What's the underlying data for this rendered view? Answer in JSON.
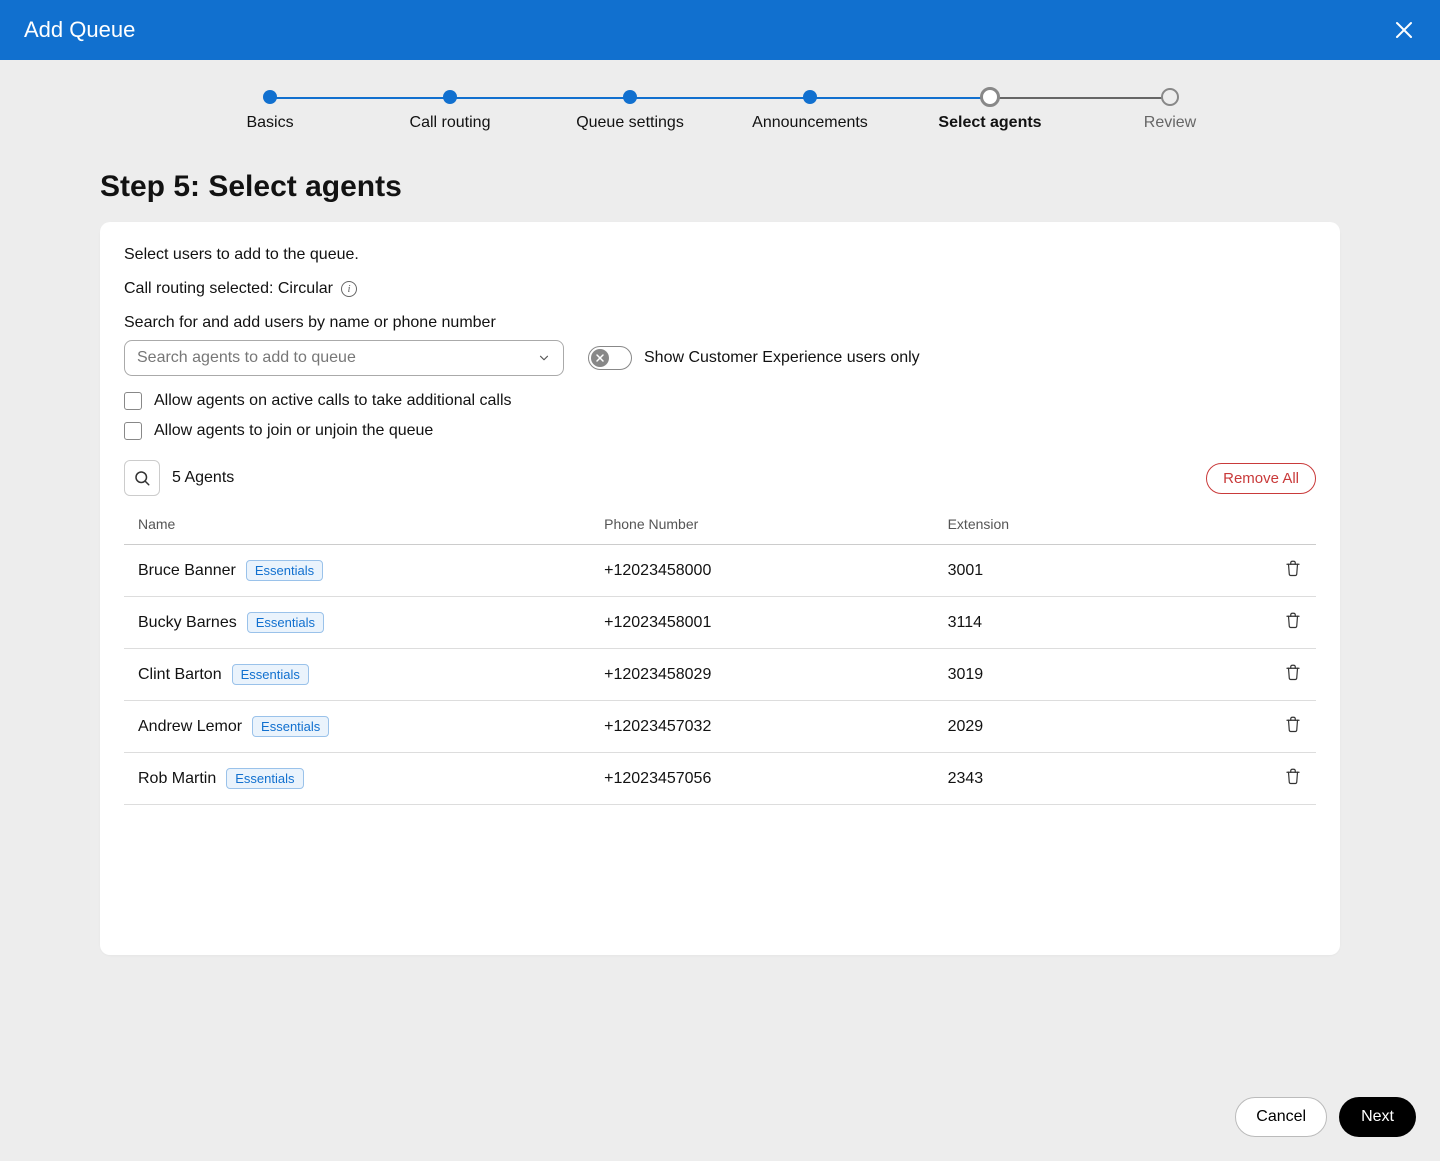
{
  "header": {
    "title": "Add Queue"
  },
  "stepper": [
    {
      "label": "Basics",
      "state": "done"
    },
    {
      "label": "Call routing",
      "state": "done"
    },
    {
      "label": "Queue settings",
      "state": "done"
    },
    {
      "label": "Announcements",
      "state": "done"
    },
    {
      "label": "Select agents",
      "state": "current"
    },
    {
      "label": "Review",
      "state": "future"
    }
  ],
  "page": {
    "title": "Step 5: Select agents",
    "intro": "Select users to add to the queue.",
    "routing_prefix": "Call routing selected: ",
    "routing_value": "Circular",
    "search_label": "Search for and add users by name or phone number",
    "search_placeholder": "Search agents to add to queue",
    "toggle_label": "Show Customer Experience users only",
    "chk1": "Allow agents on active calls to take additional calls",
    "chk2": "Allow agents to join or unjoin the queue"
  },
  "agents": {
    "count_label": "5 Agents",
    "remove_all": "Remove All",
    "columns": {
      "name": "Name",
      "phone": "Phone Number",
      "ext": "Extension"
    },
    "badge_label": "Essentials",
    "rows": [
      {
        "name": "Bruce Banner",
        "phone": "+12023458000",
        "ext": "3001"
      },
      {
        "name": "Bucky Barnes",
        "phone": "+12023458001",
        "ext": "3114"
      },
      {
        "name": "Clint Barton",
        "phone": "+12023458029",
        "ext": "3019"
      },
      {
        "name": "Andrew Lemor",
        "phone": "+12023457032",
        "ext": "2029"
      },
      {
        "name": "Rob Martin",
        "phone": "+12023457056",
        "ext": "2343"
      }
    ]
  },
  "footer": {
    "cancel": "Cancel",
    "next": "Next"
  }
}
